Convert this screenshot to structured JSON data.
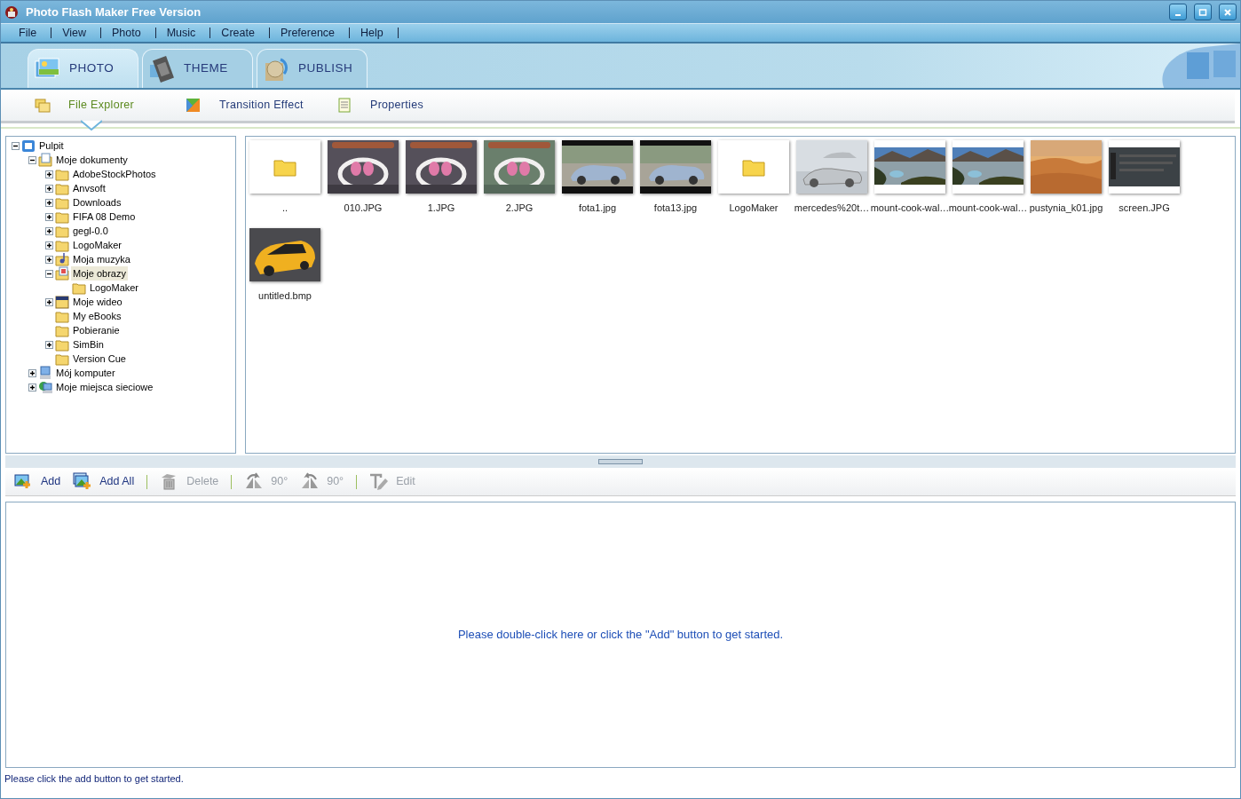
{
  "window": {
    "title": "Photo Flash Maker Free Version"
  },
  "menu": [
    "File",
    "View",
    "Photo",
    "Music",
    "Create",
    "Preference",
    "Help"
  ],
  "tabs": [
    {
      "label": "PHOTO",
      "selected": true
    },
    {
      "label": "THEME",
      "kind": "theme",
      "selected": false
    },
    {
      "label": "PUBLISH",
      "kind": "publish",
      "selected": false
    }
  ],
  "subtabs": [
    {
      "label": "File Explorer",
      "kind": "explorer",
      "selected": true
    },
    {
      "label": "Transition Effect",
      "kind": "transition",
      "selected": false
    },
    {
      "label": "Properties",
      "kind": "properties",
      "selected": false
    }
  ],
  "tree": [
    {
      "label": "Pulpit",
      "kind": "desktop",
      "expandable": true,
      "expanded": true,
      "selected": false,
      "children": [
        {
          "label": "Moje dokumenty",
          "kind": "documents",
          "expandable": true,
          "expanded": true,
          "selected": false,
          "children": [
            {
              "label": "AdobeStockPhotos",
              "kind": "folder",
              "expandable": true,
              "expanded": false,
              "selected": false
            },
            {
              "label": "Anvsoft",
              "kind": "folder",
              "expandable": true,
              "expanded": false,
              "selected": false
            },
            {
              "label": "Downloads",
              "kind": "folder",
              "expandable": true,
              "expanded": false,
              "selected": false
            },
            {
              "label": "FIFA 08 Demo",
              "kind": "folder",
              "expandable": true,
              "expanded": false,
              "selected": false
            },
            {
              "label": "gegl-0.0",
              "kind": "folder",
              "expandable": true,
              "expanded": false,
              "selected": false
            },
            {
              "label": "LogoMaker",
              "kind": "folder",
              "expandable": true,
              "expanded": false,
              "selected": false
            },
            {
              "label": "Moja muzyka",
              "kind": "music",
              "expandable": true,
              "expanded": false,
              "selected": false
            },
            {
              "label": "Moje obrazy",
              "kind": "pictures",
              "expandable": true,
              "expanded": true,
              "selected": true,
              "children": [
                {
                  "label": "LogoMaker",
                  "kind": "folder",
                  "expandable": false,
                  "selected": false
                }
              ]
            },
            {
              "label": "Moje wideo",
              "kind": "video",
              "expandable": true,
              "expanded": false,
              "selected": false
            },
            {
              "label": "My eBooks",
              "kind": "folder",
              "expandable": false,
              "selected": false
            },
            {
              "label": "Pobieranie",
              "kind": "folder",
              "expandable": false,
              "selected": false
            },
            {
              "label": "SimBin",
              "kind": "folder",
              "expandable": true,
              "expanded": false,
              "selected": false
            },
            {
              "label": "Version Cue",
              "kind": "folder",
              "expandable": false,
              "selected": false
            }
          ]
        },
        {
          "label": "Mój komputer",
          "kind": "computer",
          "expandable": true,
          "expanded": false,
          "selected": false
        },
        {
          "label": "Moje miejsca sieciowe",
          "kind": "network",
          "expandable": true,
          "expanded": false,
          "selected": false
        }
      ]
    }
  ],
  "thumbnails": [
    {
      "label": "..",
      "kind": "folder"
    },
    {
      "label": "010.JPG",
      "kind": "picture"
    },
    {
      "label": "1.JPG",
      "kind": "picture"
    },
    {
      "label": "2.JPG",
      "kind": "picture"
    },
    {
      "label": "fota1.jpg",
      "kind": "picture"
    },
    {
      "label": "fota13.jpg",
      "kind": "picture"
    },
    {
      "label": "LogoMaker",
      "kind": "folder"
    },
    {
      "label": "mercedes%20t…",
      "kind": "picture"
    },
    {
      "label": "mount-cook-wal…",
      "kind": "picture"
    },
    {
      "label": "mount-cook-wal…",
      "kind": "picture"
    },
    {
      "label": "pustynia_k01.jpg",
      "kind": "picture"
    },
    {
      "label": "screen.JPG",
      "kind": "picture"
    },
    {
      "label": "untitled.bmp",
      "kind": "picture"
    }
  ],
  "toolbar": [
    {
      "label": "Add",
      "kind": "add",
      "disabled": false
    },
    {
      "label": "Add All",
      "kind": "addall",
      "disabled": false
    },
    {
      "label": "Delete",
      "kind": "delete",
      "disabled": true
    },
    {
      "label": "90°",
      "kind": "rotate-right",
      "disabled": true
    },
    {
      "label": "90°",
      "kind": "rotate-left",
      "disabled": true
    },
    {
      "label": "Edit",
      "kind": "edit",
      "disabled": true
    }
  ],
  "drop_area": {
    "hint": "Please double-click here or click the \"Add\" button to get started."
  },
  "status_bar": {
    "text": "Please click the add button to get started."
  }
}
